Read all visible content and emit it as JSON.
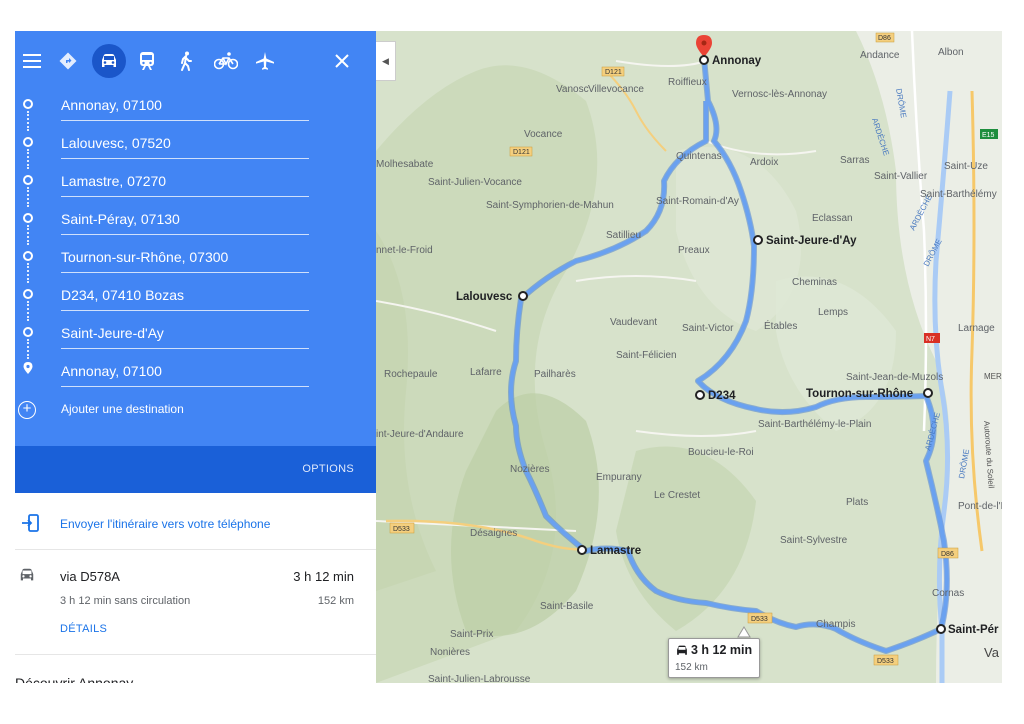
{
  "colors": {
    "panel_blue": "#4285f4",
    "options_blue": "#1a60d8",
    "link_blue": "#1a73e8",
    "route_blue": "#6aa1f0",
    "pin_red": "#ea4335"
  },
  "travel_modes": [
    {
      "name": "best-route",
      "icon": "diamond-directions-icon",
      "glyph": "◈"
    },
    {
      "name": "driving",
      "icon": "car-icon",
      "glyph": "car",
      "selected": true
    },
    {
      "name": "transit",
      "icon": "train-icon",
      "glyph": "🚆"
    },
    {
      "name": "walking",
      "icon": "walking-icon",
      "glyph": "🚶"
    },
    {
      "name": "cycling",
      "icon": "bicycle-icon",
      "glyph": "🚲"
    },
    {
      "name": "flight",
      "icon": "airplane-icon",
      "glyph": "✈"
    }
  ],
  "destinations": [
    "Annonay, 07100",
    "Lalouvesc, 07520",
    "Lamastre, 07270",
    "Saint-Péray, 07130",
    "Tournon-sur-Rhône, 07300",
    "D234, 07410 Bozas",
    "Saint-Jeure-d'Ay",
    "Annonay, 07100"
  ],
  "add_destination": "Ajouter une destination",
  "options_label": "OPTIONS",
  "send_to_phone": "Envoyer l'itinéraire vers votre téléphone",
  "route": {
    "via": "via D578A",
    "duration": "3 h 12 min",
    "without_traffic": "3 h 12 min sans circulation",
    "distance": "152 km",
    "details_label": "DÉTAILS"
  },
  "discover": "Découvrir Annonay",
  "map": {
    "route_chip": {
      "duration": "3 h 12 min",
      "distance": "152 km"
    },
    "stops": [
      "Annonay",
      "Lalouvesc",
      "Lamastre",
      "Saint-Pér",
      "Tournon-sur-Rhône",
      "D234",
      "Saint-Jeure-d'Ay"
    ],
    "places": [
      "Vanosc",
      "Villevocance",
      "Roiffieux",
      "Vernosc-lès-Annonay",
      "Andance",
      "Albon",
      "Vocance",
      "Quintenas",
      "Ardoix",
      "Sarras",
      "Saint-Uze",
      "Saint-Vallier",
      "Saint-Barthélémy",
      "Molhesabate",
      "Saint-Julien-Vocance",
      "Saint-Symphorien-de-Mahun",
      "Saint-Romain-d'Ay",
      "Satillieu",
      "Preaux",
      "Eclassan",
      "nnet-le-Froid",
      "Cheminas",
      "Lemps",
      "Vaudevant",
      "Saint-Victor",
      "Étables",
      "Larnage",
      "Saint-Félicien",
      "Rochepaule",
      "Lafarre",
      "Pailharès",
      "Saint-Jean-de-Muzols",
      "Saint-Barthélémy-le-Plain",
      "int-Jeure-d'Andaure",
      "Boucieu-le-Roi",
      "Nozières",
      "Empurany",
      "Le Crestet",
      "Plats",
      "Pont-de-l'Isè",
      "Désaignes",
      "Saint-Sylvestre",
      "Saint-Basile",
      "Cornas",
      "Champis",
      "Saint-Prix",
      "Nonières",
      "Saint-Julien-Labrousse",
      "Va"
    ],
    "roads": [
      "D86",
      "D121",
      "D121",
      "E15",
      "N7",
      "D533",
      "D533",
      "D533",
      "D86"
    ],
    "rivers": [
      "ARDÈCHE",
      "DRÔME",
      "ARDÈCHE",
      "DRÔME",
      "ARDÈCHE",
      "DRÔME",
      "Autoroute du Soleil",
      "MER"
    ]
  }
}
